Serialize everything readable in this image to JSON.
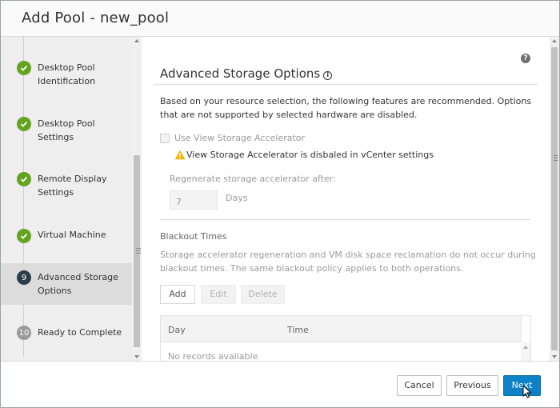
{
  "dialog": {
    "title": "Add Pool - new_pool"
  },
  "steps": [
    {
      "label": "Desktop Pool Identification",
      "state": "done"
    },
    {
      "label": "Desktop Pool Settings",
      "state": "done"
    },
    {
      "label": "Remote Display Settings",
      "state": "done"
    },
    {
      "label": "Virtual Machine",
      "state": "done"
    },
    {
      "number": "9",
      "label": "Advanced Storage Options",
      "state": "current"
    },
    {
      "number": "10",
      "label": "Ready to Complete",
      "state": "todo"
    }
  ],
  "content": {
    "help_icon": "?",
    "section_title": "Advanced Storage Options",
    "info_icon": "i",
    "description": "Based on your resource selection, the following features are recommended. Options that are not supported by selected hardware are disabled.",
    "accelerator_checkbox_label": "Use View Storage Accelerator",
    "accelerator_checked": false,
    "warning_text": "View Storage Accelerator is disbaled in vCenter settings",
    "regenerate_label": "Regenerate storage accelerator after:",
    "regenerate_value": "7",
    "regenerate_unit": "Days",
    "blackout": {
      "title": "Blackout Times",
      "description": "Storage accelerator regeneration and VM disk space reclamation do not occur during blackout times. The same blackout policy applies to both operations.",
      "add_label": "Add",
      "edit_label": "Edit",
      "delete_label": "Delete",
      "columns": [
        "Day",
        "Time"
      ],
      "empty_text": "No records available"
    }
  },
  "footer": {
    "cancel_label": "Cancel",
    "previous_label": "Previous",
    "next_label": "Next"
  },
  "colors": {
    "primary": "#0f81c7",
    "done": "#62a420",
    "current": "#2c3d49",
    "todo": "#9a9a9a",
    "warning": "#f5b300"
  }
}
